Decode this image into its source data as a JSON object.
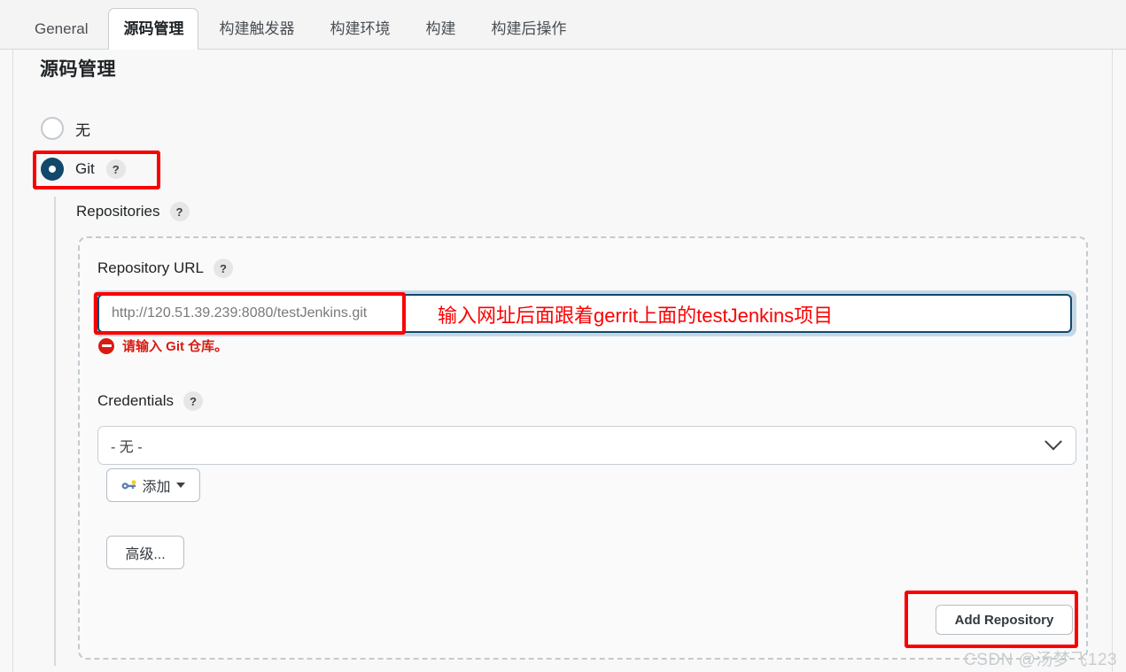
{
  "tabs": [
    {
      "label": "General",
      "active": false
    },
    {
      "label": "源码管理",
      "active": true
    },
    {
      "label": "构建触发器",
      "active": false
    },
    {
      "label": "构建环境",
      "active": false
    },
    {
      "label": "构建",
      "active": false
    },
    {
      "label": "构建后操作",
      "active": false
    }
  ],
  "page": {
    "section_title": "源码管理"
  },
  "scm": {
    "options": [
      {
        "label": "无",
        "selected": false
      },
      {
        "label": "Git",
        "selected": true,
        "help": "?"
      }
    ]
  },
  "git": {
    "repositories_label": "Repositories",
    "repositories_help": "?",
    "repository_url": {
      "label": "Repository URL",
      "help": "?",
      "value": "http://120.51.39.239:8080/testJenkins.git",
      "placeholder": "http://120.51.39.239:8080/testJenkins.git",
      "error": "请输入 Git 仓库。"
    },
    "credentials": {
      "label": "Credentials",
      "help": "?",
      "selected": "- 无 -",
      "add_button": "添加"
    },
    "advanced_button": "高级...",
    "add_repository_button": "Add Repository"
  },
  "annotations": {
    "url_note": "输入网址后面跟着gerrit上面的testJenkins项目"
  },
  "watermark": "CSDN @汤梦飞123",
  "colors": {
    "accent": "#11486b",
    "error": "#d81b12",
    "annotation": "#fb0000",
    "focus_ring": "#c4d7e6"
  }
}
